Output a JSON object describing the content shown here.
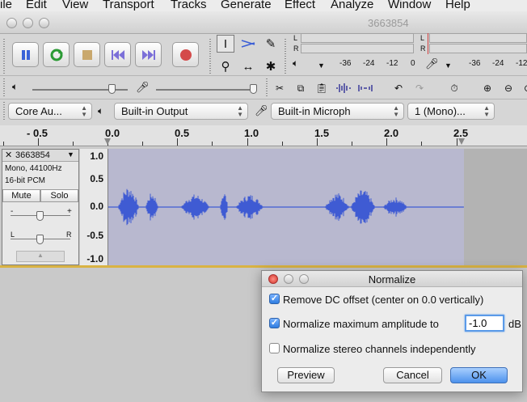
{
  "menubar": [
    "ile",
    "Edit",
    "View",
    "Transport",
    "Tracks",
    "Generate",
    "Effect",
    "Analyze",
    "Window",
    "Help"
  ],
  "window": {
    "title": "3663854"
  },
  "meters": {
    "channel_l": "L",
    "channel_r": "R",
    "playback_scale": [
      "-36",
      "-24",
      "-12",
      "0"
    ],
    "record_scale": [
      "-36",
      "-24",
      "-12"
    ]
  },
  "devices": {
    "host": "Core Au...",
    "output": "Built-in Output",
    "input": "Built-in Microph",
    "channels": "1 (Mono)..."
  },
  "ruler": {
    "labels": [
      "- 0.5",
      "0.0",
      "0.5",
      "1.0",
      "1.5",
      "2.0",
      "2.5"
    ]
  },
  "track": {
    "name": "3663854",
    "info_rate": "Mono, 44100Hz",
    "info_format": "16-bit PCM",
    "mute_label": "Mute",
    "solo_label": "Solo",
    "gain_minus": "-",
    "gain_plus": "+",
    "pan_left": "L",
    "pan_right": "R",
    "vruler": [
      "1.0",
      "0.5",
      "0.0",
      "-0.5",
      "-1.0"
    ]
  },
  "dialog": {
    "title": "Normalize",
    "remove_dc_label": "Remove DC offset (center on 0.0 vertically)",
    "remove_dc_checked": true,
    "normalize_label": "Normalize maximum amplitude to",
    "normalize_checked": true,
    "amplitude_value": "-1.0",
    "amplitude_unit": "dB",
    "stereo_label": "Normalize stereo channels independently",
    "stereo_checked": false,
    "preview_label": "Preview",
    "cancel_label": "Cancel",
    "ok_label": "OK"
  },
  "colors": {
    "waveform": "#3f5bd3",
    "wave_bg": "#b8b8cf",
    "track_selected_border": "#d9b343"
  }
}
